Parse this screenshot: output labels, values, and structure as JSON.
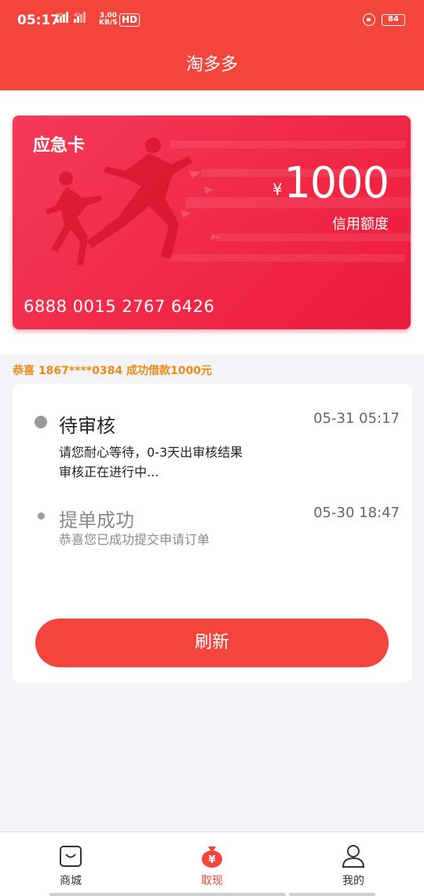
{
  "status_bar": {
    "time": "05:17",
    "signal": "2G 4G",
    "speed": "3.00\nKB/S",
    "hd": "HD",
    "battery": "84"
  },
  "header": {
    "title": "淘多多"
  },
  "card": {
    "label": "应急卡",
    "currency": "¥",
    "amount": "1000",
    "credit_label": "信用额度",
    "number": "6888 0015 2767 6426"
  },
  "ticker": "恭喜 1867****0384 成功借款1000元",
  "steps": [
    {
      "title": "待审核",
      "time": "05-31  05:17",
      "lines": [
        "请您耐心等待，0-3天出审核结果",
        "审核正在进行中..."
      ]
    },
    {
      "title": "提单成功",
      "time": "05-30 18:47",
      "lines": [
        "恭喜您已成功提交申请订单"
      ]
    }
  ],
  "refresh_label": "刷新",
  "tabs": [
    {
      "label": "商城",
      "icon": "shop-bag-icon"
    },
    {
      "label": "取现",
      "icon": "money-bag-icon",
      "active": true
    },
    {
      "label": "我的",
      "icon": "user-icon"
    }
  ],
  "colors": {
    "primary": "#f3453b",
    "card": "#f12a48",
    "ticker": "#f08a10"
  }
}
